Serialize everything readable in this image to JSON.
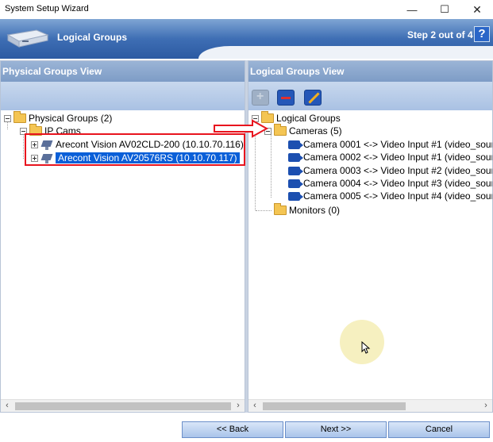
{
  "window": {
    "title": "System Setup Wizard"
  },
  "banner": {
    "heading": "Logical Groups",
    "step": "Step 2 out of 4",
    "help": "?"
  },
  "left_panel": {
    "header": "Physical Groups View",
    "tree": {
      "root": "Physical Groups (2)",
      "group": "IP Cams",
      "devices": [
        "Arecont Vision AV02CLD-200 (10.10.70.116)",
        "Arecont Vision AV20576RS (10.10.70.117)"
      ]
    }
  },
  "right_panel": {
    "header": "Logical Groups View",
    "tree": {
      "root": "Logical Groups",
      "cameras_group": "Cameras (5)",
      "cameras": [
        "Camera 0001 <-> Video Input #1 (video_sour",
        "Camera 0002 <-> Video Input #1 (video_sour",
        "Camera 0003 <-> Video Input #2 (video_sour",
        "Camera 0004 <-> Video Input #3 (video_sour",
        "Camera 0005 <-> Video Input #4 (video_sour"
      ],
      "monitors_group": "Monitors (0)"
    }
  },
  "footer": {
    "back": "<< Back",
    "next": "Next >>",
    "cancel": "Cancel"
  },
  "colors": {
    "banner": "#3e6eb4",
    "selection": "#0a5fd8",
    "highlight": "#e8141e"
  }
}
